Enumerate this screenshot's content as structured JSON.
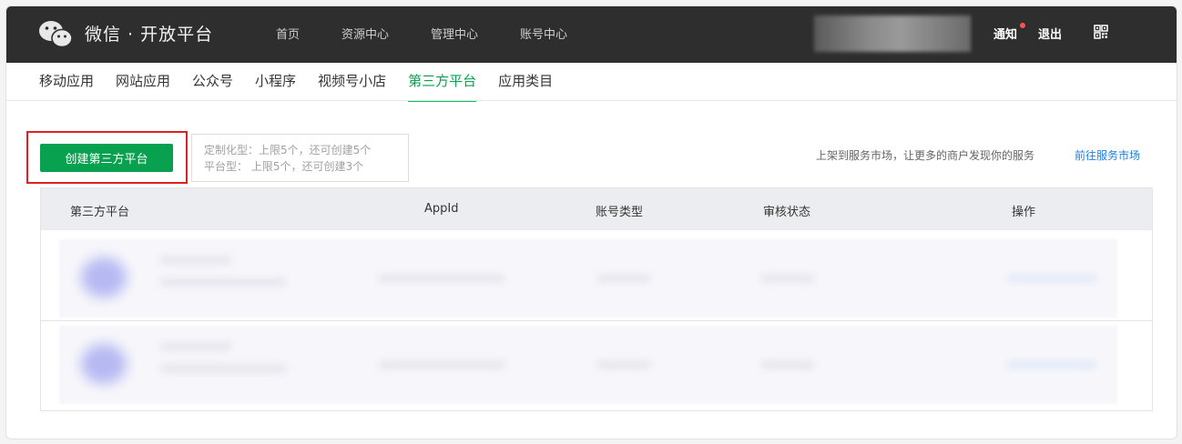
{
  "header": {
    "brand": "微信 · 开放平台",
    "nav": [
      "首页",
      "资源中心",
      "管理中心",
      "账号中心"
    ],
    "notify_label": "通知",
    "logout_label": "退出",
    "icons": {
      "logo": "wechat-logo-icon",
      "qr": "qr-code-icon"
    }
  },
  "tabs": {
    "items": [
      "移动应用",
      "网站应用",
      "公众号",
      "小程序",
      "视频号小店",
      "第三方平台",
      "应用类目"
    ],
    "active": "第三方平台"
  },
  "actions": {
    "create_label": "创建第三方平台",
    "quota_line1": "定制化型：上限5个，还可创建5个",
    "quota_line2": "平台型： 上限5个，还可创建3个",
    "market_text": "上架到服务市场，让更多的商户发现你的服务",
    "market_link": "前往服务市场"
  },
  "table": {
    "columns": [
      "第三方平台",
      "AppId",
      "账号类型",
      "审核状态",
      "操作"
    ]
  },
  "colors": {
    "accent": "#07c160",
    "link": "#1d7ee0",
    "header_bg": "#2e2e2e",
    "highlight": "#e02020"
  }
}
